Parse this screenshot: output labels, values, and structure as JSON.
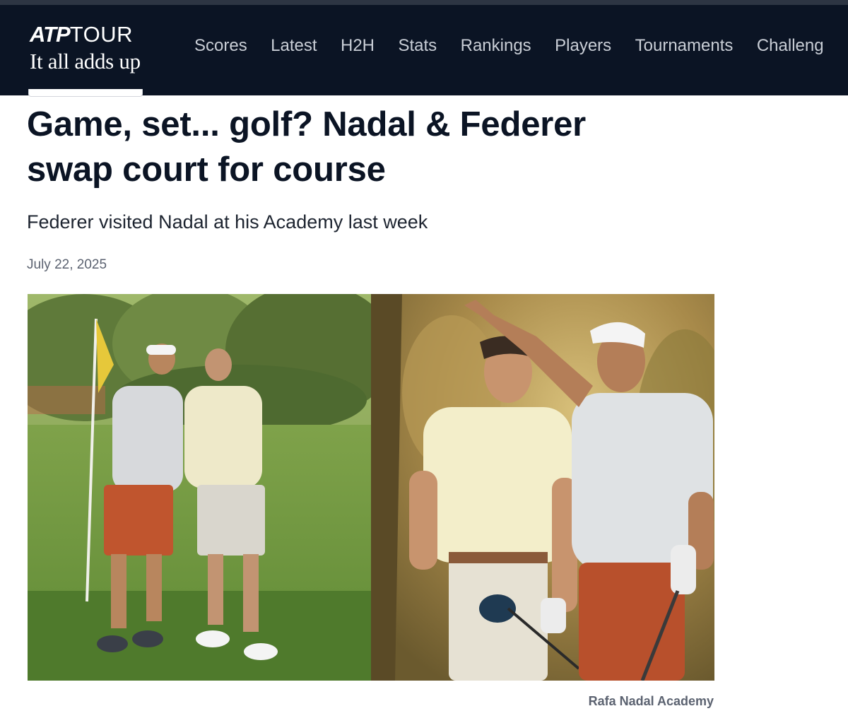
{
  "header": {
    "logo_main": "ATP",
    "logo_tour": "TOUR",
    "logo_tagline": "It all adds up",
    "nav": [
      "Scores",
      "Latest",
      "H2H",
      "Stats",
      "Rankings",
      "Players",
      "Tournaments",
      "Challeng"
    ]
  },
  "article": {
    "headline_line1": "Game, set... golf? Nadal & Federer",
    "headline_line2": "swap court for course",
    "subtitle": "Federer visited Nadal at his Academy last week",
    "date": "July 22, 2025",
    "photo_credit": "Rafa Nadal Academy"
  },
  "colors": {
    "nav_bg": "#0b1424",
    "headline": "#0b1424",
    "meta_text": "#5b6270"
  }
}
